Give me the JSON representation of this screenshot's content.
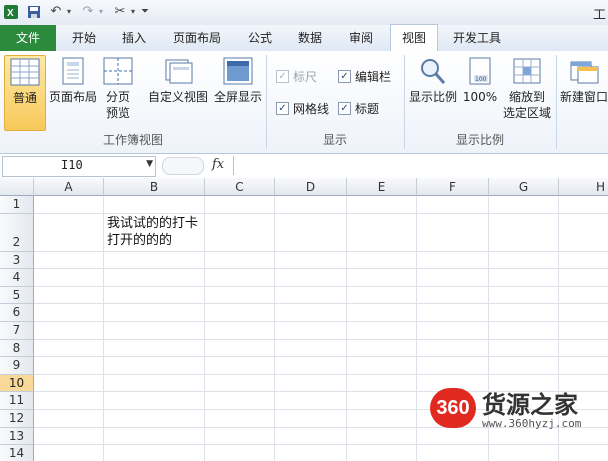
{
  "window": {
    "title_fragment": "工"
  },
  "tabs": [
    {
      "label": "文件"
    },
    {
      "label": "开始"
    },
    {
      "label": "插入"
    },
    {
      "label": "页面布局"
    },
    {
      "label": "公式"
    },
    {
      "label": "数据"
    },
    {
      "label": "审阅"
    },
    {
      "label": "视图",
      "active": true
    },
    {
      "label": "开发工具"
    }
  ],
  "ribbon": {
    "groups": {
      "workbook_views": "工作簿视图",
      "show": "显示",
      "zoom": "显示比例"
    },
    "buttons": {
      "normal": "普通",
      "page_layout": "页面布局",
      "page_break_1": "分页",
      "page_break_2": "预览",
      "custom_views": "自定义视图",
      "full_screen": "全屏显示",
      "zoom": "显示比例",
      "zoom100": "100%",
      "zoom_sel_1": "缩放到",
      "zoom_sel_2": "选定区域",
      "new_window": "新建窗口"
    },
    "checks": {
      "ruler": {
        "label": "标尺",
        "checked": true,
        "disabled": true
      },
      "formula_bar": {
        "label": "编辑栏",
        "checked": true
      },
      "gridlines": {
        "label": "网格线",
        "checked": true
      },
      "headings": {
        "label": "标题",
        "checked": true
      }
    }
  },
  "formula_bar": {
    "name_box": "I10",
    "fx": "fx",
    "value": ""
  },
  "sheet": {
    "columns": [
      "A",
      "B",
      "C",
      "D",
      "E",
      "F",
      "G",
      "H"
    ],
    "rows": [
      "1",
      "2",
      "3",
      "4",
      "5",
      "6",
      "7",
      "8",
      "9",
      "10",
      "11",
      "12",
      "13",
      "14"
    ],
    "selected_row": "10",
    "cells": {
      "B2": "我试试的的打卡打开的的的"
    }
  },
  "watermark": {
    "logo": "360",
    "name": "货源之家",
    "url": "www.360hyzj.com"
  },
  "colors": {
    "file_tab": "#2c8a3d",
    "selected_header": "#f9d99a",
    "watermark_red": "#e0291f"
  }
}
